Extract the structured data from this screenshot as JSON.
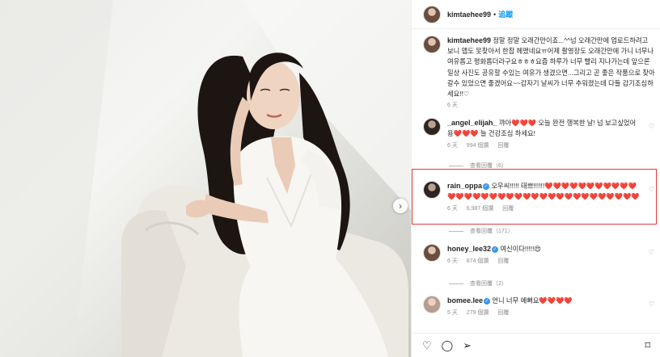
{
  "header": {
    "username": "kimtaehee99",
    "separator": "•",
    "follow_label": "追蹤"
  },
  "caption": {
    "username": "kimtaehee99",
    "text": "정말 정말 오래간만이죠...^^넘 오래간만에 업로드하려고 보니 앱도 못찾아서 한참 헤맸네요ㅠ어제 촬영장도 오래간만에 가니 너무나 여유롭고 평화롭더라구요ㅎㅎㅎ요즘 하루가 너무 빨리 지나가는데 앞으론 일상 사진도 공유할 수있는 여유가 생겼으면...그리고 곧 좋은 작품으로 찾아갈수 있었으면 좋겠어요~~갑자기 날씨가 너무 추워졌는데 다들 감기조심하세요!!♡",
    "time": "6 天"
  },
  "comments": [
    {
      "username": "_angel_elijah_",
      "text": "꺄아❤️❤️❤️ 오늘 완전 행복한 날! 넘 보고싶었어용❤️❤️❤️ 늘 건강조심 하세요!",
      "time": "6 天",
      "likes": "994 個讚",
      "reply": "回覆",
      "replies_label": "查看回覆（6）",
      "verified": false
    },
    {
      "username": "rain_oppa",
      "text": "오우씨!!!!! 태쁘!!!!!!❤️❤️❤️❤️❤️❤️❤️❤️❤️❤️❤️❤️❤️❤️❤️❤️❤️❤️❤️❤️❤️❤️❤️❤️❤️❤️❤️❤️❤️❤️❤️❤️❤️❤️",
      "time": "6 天",
      "likes": "6,987 個讚",
      "reply": "回覆",
      "replies_label": "查看回覆（171）",
      "verified": true
    },
    {
      "username": "honey_lee32",
      "text": "여신이다!!!!!😍",
      "time": "6 天",
      "likes": "874 個讚",
      "reply": "回覆",
      "replies_label": "查看回覆（2）",
      "verified": true
    },
    {
      "username": "bomee.lee",
      "text": "언니 너무 예뻐요❤️❤️❤️❤️",
      "time": "5 天",
      "likes": "279 個讚",
      "reply": "回覆",
      "verified": true
    }
  ],
  "icons": {
    "heart": "heart-icon",
    "comment": "comment-icon",
    "share": "share-icon",
    "save": "bookmark-icon",
    "verified": "verified-badge-icon",
    "next": "chevron-right-icon"
  },
  "colors": {
    "follow": "#0095f6",
    "highlight": "#e33b3b",
    "heart": "#ed4956",
    "verified": "#3897f0"
  }
}
